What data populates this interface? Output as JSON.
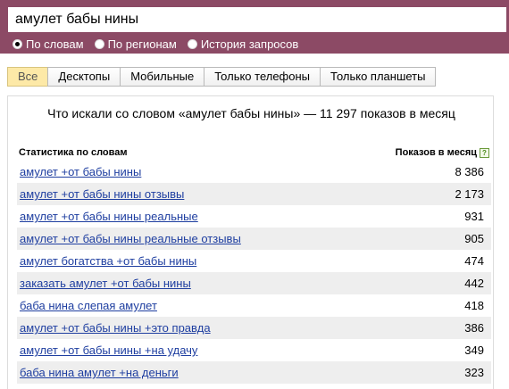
{
  "search": {
    "value": "амулет бабы нины"
  },
  "modes": [
    {
      "label": "По словам",
      "checked": true
    },
    {
      "label": "По регионам",
      "checked": false
    },
    {
      "label": "История запросов",
      "checked": false
    }
  ],
  "tabs": [
    "Все",
    "Десктопы",
    "Мобильные",
    "Только телефоны",
    "Только планшеты"
  ],
  "panel": {
    "title": "Что искали со словом «амулет бабы нины» — 11 297 показов в месяц",
    "col_left": "Статистика по словам",
    "col_right": "Показов в месяц",
    "help_glyph": "?"
  },
  "rows": [
    {
      "phrase": "амулет +от бабы нины",
      "count": "8 386"
    },
    {
      "phrase": "амулет +от бабы нины отзывы",
      "count": "2 173"
    },
    {
      "phrase": "амулет +от бабы нины реальные",
      "count": "931"
    },
    {
      "phrase": "амулет +от бабы нины реальные отзывы",
      "count": "905"
    },
    {
      "phrase": "амулет богатства +от бабы нины",
      "count": "474"
    },
    {
      "phrase": "заказать амулет +от бабы нины",
      "count": "442"
    },
    {
      "phrase": "баба нина слепая амулет",
      "count": "418"
    },
    {
      "phrase": "амулет +от бабы нины +это правда",
      "count": "386"
    },
    {
      "phrase": "амулет +от бабы нины +на удачу",
      "count": "349"
    },
    {
      "phrase": "баба нина амулет +на деньги",
      "count": "323"
    }
  ]
}
